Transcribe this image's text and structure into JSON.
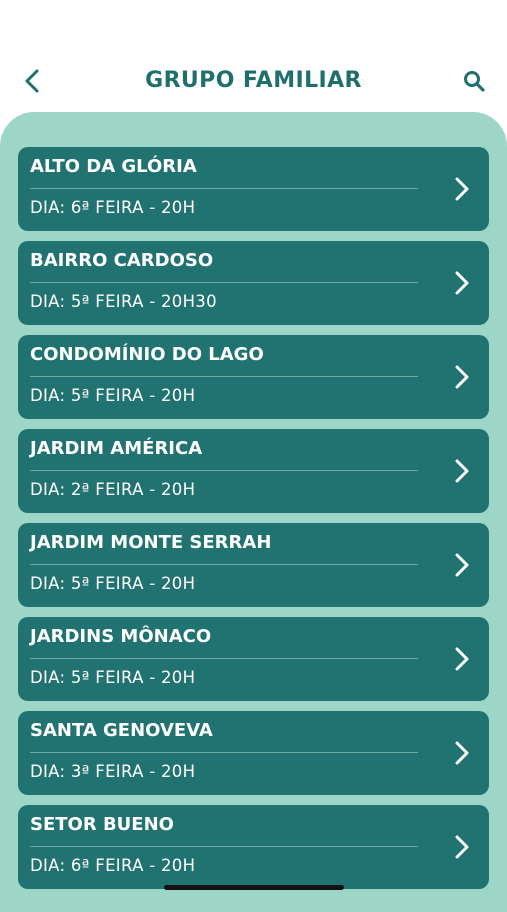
{
  "header": {
    "title": "GRUPO FAMILIAR",
    "back_icon": "chevron-left-icon",
    "search_icon": "search-icon"
  },
  "colors": {
    "accent": "#1f6f6d",
    "card": "#217371",
    "panel": "#9dd6c6",
    "text_on_card": "#ffffff"
  },
  "groups": [
    {
      "name": "ALTO DA GLÓRIA",
      "day": "DIA: 6ª FEIRA - 20H"
    },
    {
      "name": "BAIRRO CARDOSO",
      "day": "DIA: 5ª FEIRA - 20H30"
    },
    {
      "name": "CONDOMÍNIO DO LAGO",
      "day": "DIA: 5ª FEIRA - 20H"
    },
    {
      "name": "JARDIM AMÉRICA",
      "day": "DIA: 2ª FEIRA - 20H"
    },
    {
      "name": "JARDIM MONTE SERRAH",
      "day": "DIA: 5ª FEIRA - 20H"
    },
    {
      "name": "JARDINS MÔNACO",
      "day": "DIA: 5ª FEIRA - 20H"
    },
    {
      "name": "SANTA GENOVEVA",
      "day": "DIA: 3ª FEIRA - 20H"
    },
    {
      "name": "SETOR BUENO",
      "day": "DIA: 6ª FEIRA - 20H"
    }
  ]
}
